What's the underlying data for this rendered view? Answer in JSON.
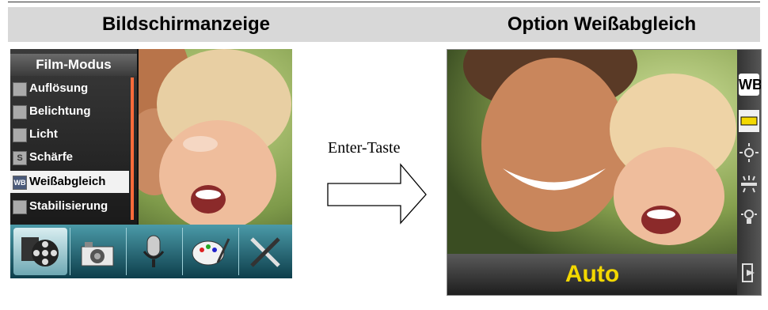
{
  "header": {
    "left_title": "Bildschirmanzeige",
    "right_title": "Option Weißabgleich"
  },
  "left_screen": {
    "menu_title": "Film-Modus",
    "menu_items": [
      {
        "label": "Auflösung",
        "icon": "resolution-icon"
      },
      {
        "label": "Belichtung",
        "icon": "exposure-icon"
      },
      {
        "label": "Licht",
        "icon": "light-icon"
      },
      {
        "label": "Schärfe",
        "icon": "sharpness-icon",
        "glyph": "S"
      },
      {
        "label": "Weißabgleich",
        "icon": "white-balance-icon",
        "glyph": "WB",
        "selected": true
      },
      {
        "label": "Stabilisierung",
        "icon": "stabilization-icon"
      }
    ],
    "tabs": [
      "film-reel-icon",
      "camera-icon",
      "microphone-icon",
      "palette-icon",
      "tools-icon"
    ]
  },
  "arrow": {
    "label": "Enter-Taste"
  },
  "right_screen": {
    "wb_badge": "WB",
    "wb_options": [
      "auto-wb-icon",
      "daylight-icon",
      "fluorescent-icon",
      "tungsten-icon",
      "exit-icon"
    ],
    "selected_value": "Auto"
  },
  "colors": {
    "header_band": "#d8d8d8",
    "auto_text": "#f3d800",
    "tabbar": "#2a7482",
    "scroll_thumb": "#ff6b3a"
  }
}
